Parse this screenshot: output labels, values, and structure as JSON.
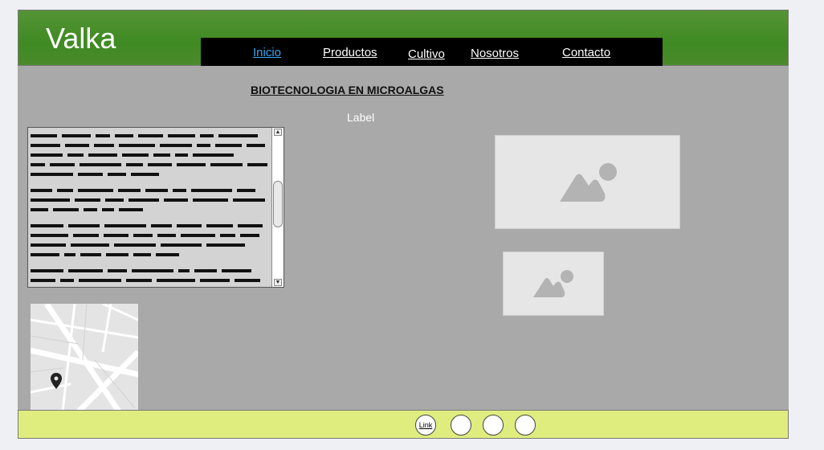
{
  "header": {
    "logo": "Valka"
  },
  "nav": {
    "items": [
      {
        "label": "Inicio",
        "active": true
      },
      {
        "label": "Productos",
        "active": false
      },
      {
        "label": "Cultivo",
        "active": false
      },
      {
        "label": "Nosotros",
        "active": false
      },
      {
        "label": "Contacto",
        "active": false
      }
    ]
  },
  "main": {
    "title": "BIOTECNOLOGIA EN MICROALGAS",
    "label": "Label"
  },
  "footer": {
    "link_label": "Link"
  },
  "colors": {
    "header_green": "#4a8a2c",
    "nav_bg": "#000000",
    "active_link": "#3aa6ee",
    "content_bg": "#a9a9a9",
    "footer_bg": "#dfec7e"
  },
  "icons": [
    "image-placeholder-icon",
    "map-pin-icon",
    "scroll-up-icon",
    "scroll-down-icon"
  ]
}
